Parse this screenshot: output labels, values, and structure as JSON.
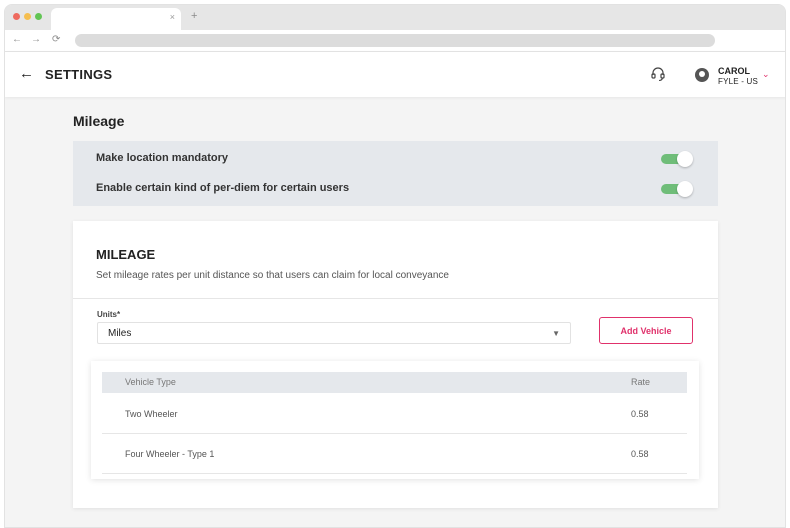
{
  "browser": {
    "dot_colors": [
      "#ee6a5f",
      "#f5be4f",
      "#62c554"
    ],
    "tab_close": "×",
    "new_tab": "+",
    "back": "←",
    "forward": "→",
    "reload": "⟳"
  },
  "header": {
    "back_icon": "←",
    "title": "SETTINGS",
    "user_name": "CAROL",
    "user_org": "FYLE - US",
    "chevron": "⌄"
  },
  "section": {
    "title": "Mileage"
  },
  "toggles": [
    {
      "label": "Make location mandatory",
      "on": true
    },
    {
      "label": "Enable certain kind of per-diem for certain users",
      "on": true
    }
  ],
  "mileage_card": {
    "title": "MILEAGE",
    "description": "Set mileage rates per unit distance so that users can claim for local conveyance",
    "units_label": "Units*",
    "units_value": "Miles",
    "add_vehicle_label": "Add Vehicle"
  },
  "vehicles_table": {
    "headers": [
      "Vehicle Type",
      "Rate"
    ],
    "rows": [
      {
        "type": "Two Wheeler",
        "rate": "0.58"
      },
      {
        "type": "Four Wheeler - Type 1",
        "rate": "0.58"
      }
    ]
  },
  "colors": {
    "accent": "#e0316b",
    "toggle_on": "#6fbd79",
    "panel_bg": "#e5e8ec"
  },
  "icons": {
    "headset": "headset-icon",
    "avatar": "user-avatar-icon",
    "select_caret": "▼"
  }
}
